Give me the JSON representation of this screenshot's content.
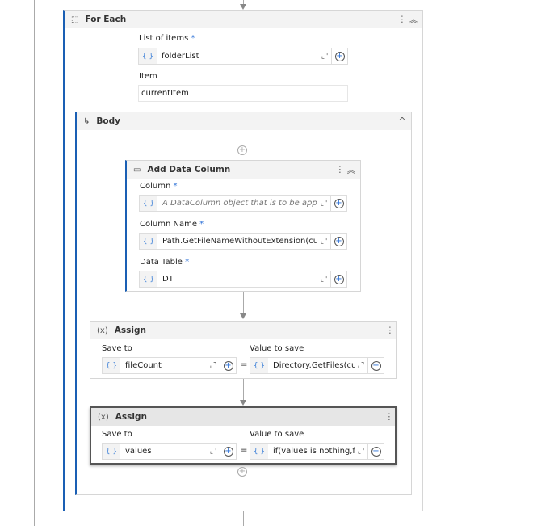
{
  "foreach": {
    "title": "For Each",
    "list_label": "List of items",
    "list_value": "folderList",
    "item_label": "Item",
    "item_value": "currentItem"
  },
  "body": {
    "title": "Body"
  },
  "adc": {
    "title": "Add Data Column",
    "column_label": "Column",
    "column_placeholder": "A DataColumn object that is to be appended",
    "colname_label": "Column Name",
    "colname_value": "Path.GetFileNameWithoutExtension(currentItem)",
    "table_label": "Data Table",
    "table_value": "DT"
  },
  "assign1": {
    "title": "Assign",
    "save_label": "Save to",
    "save_value": "fileCount",
    "value_label": "Value to save",
    "value_value": "Directory.GetFiles(currentItem)"
  },
  "assign2": {
    "title": "Assign",
    "save_label": "Save to",
    "save_value": "values",
    "value_label": "Value to save",
    "value_value": "if(values is nothing,fileCount"
  },
  "common": {
    "required": "*",
    "brace": "{ }",
    "equals": "=",
    "expand": "⌞⌝",
    "plus": "+",
    "more": "⋮",
    "collapse": "︽",
    "collapse_single": "^",
    "assign_icon": "(x)",
    "body_icon": "↳",
    "foreach_icon": "⬚",
    "adc_icon": "▭"
  }
}
